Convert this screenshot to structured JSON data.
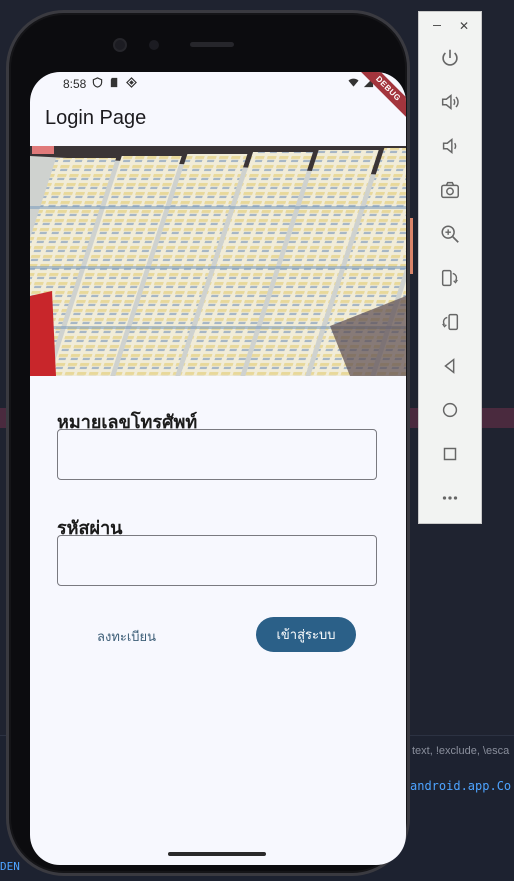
{
  "app": {
    "title": "Login Page",
    "debug_banner": "DEBUG"
  },
  "status_bar": {
    "time": "8:58"
  },
  "form": {
    "phone_label": "หมายเลขโทรศัพท์",
    "phone_value": "",
    "password_label": "รหัสผ่าน",
    "password_value": ""
  },
  "buttons": {
    "register_label": "ลงทะเบียน",
    "login_label": "เข้าสู่ระบบ"
  },
  "colors": {
    "primary": "#2b6088",
    "background": "#f7f8fe",
    "text_button": "#3e5f78"
  },
  "emulator_toolbar": {
    "icons": [
      "power-icon",
      "volume-up-icon",
      "volume-down-icon",
      "camera-icon",
      "zoom-icon",
      "rotate-left-icon",
      "rotate-right-icon",
      "back-icon",
      "home-icon",
      "overview-icon",
      "more-icon"
    ]
  },
  "ide": {
    "hint_text": "text, !exclude, \\esca",
    "code_text": "android.app.Co",
    "code_left": "DEN"
  }
}
